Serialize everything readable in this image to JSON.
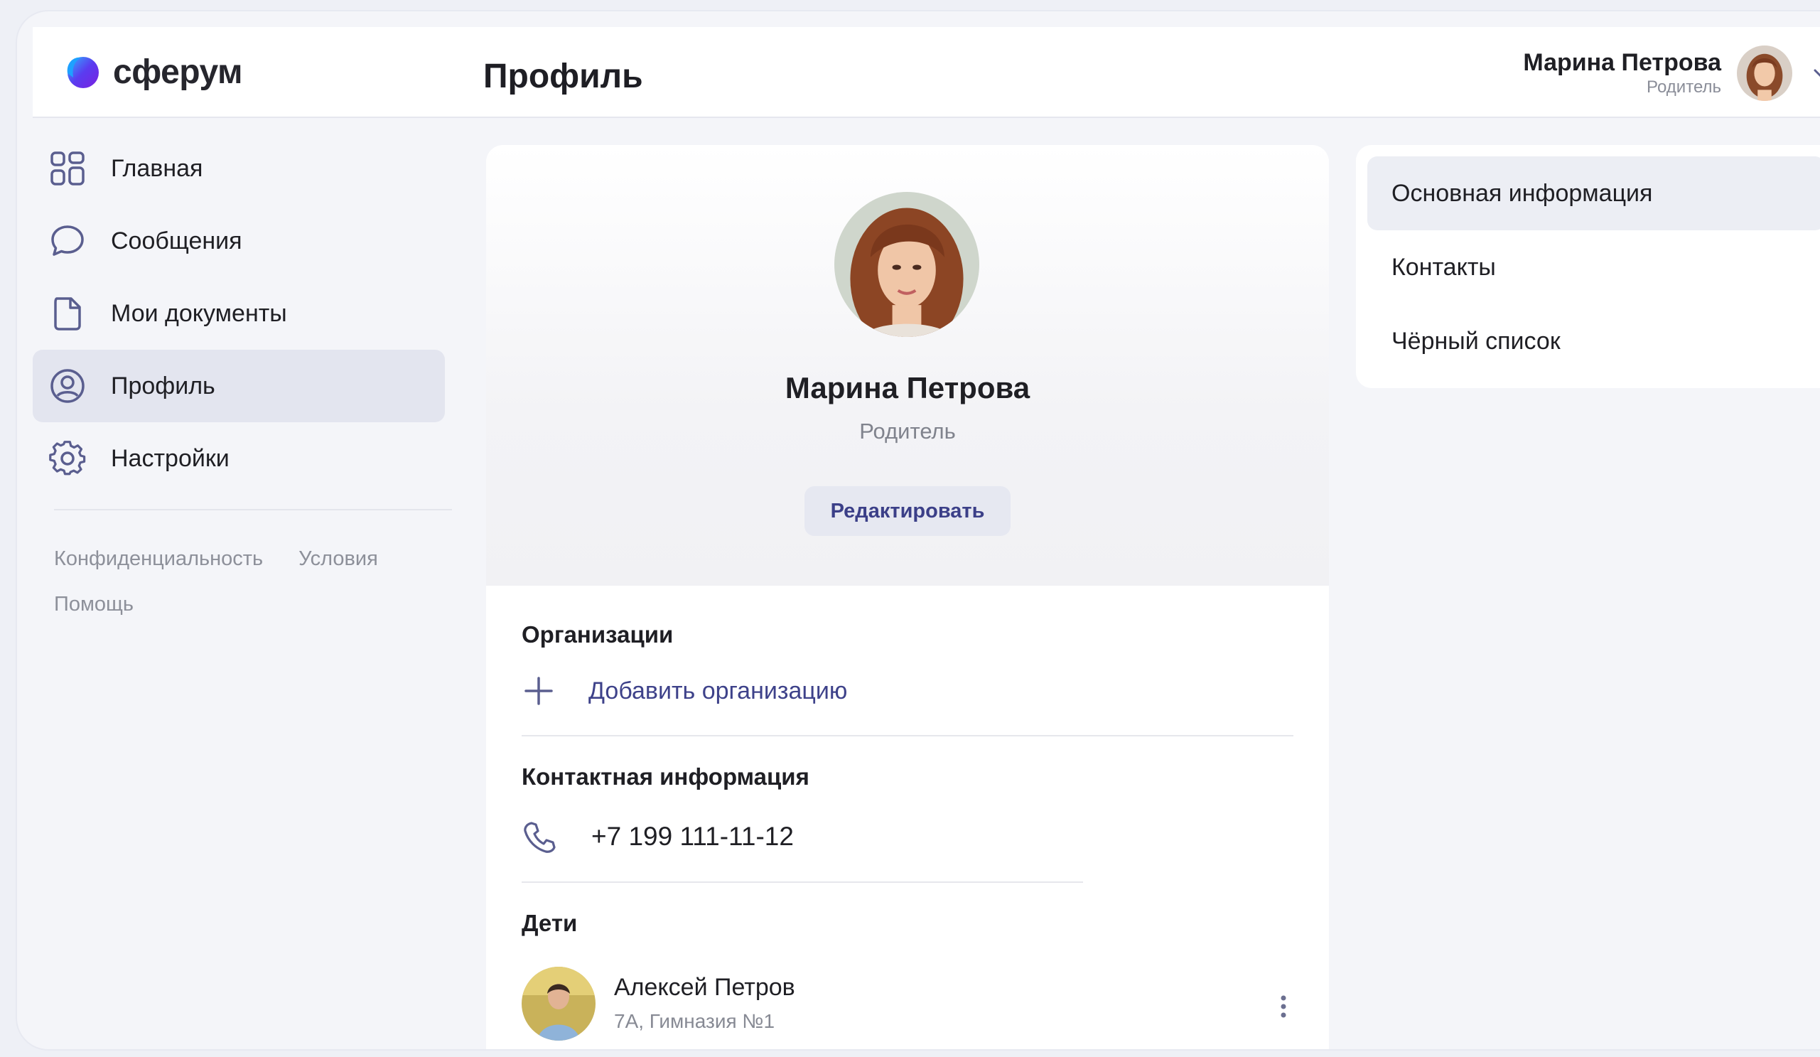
{
  "app": {
    "logo_text": "сферум",
    "page_title": "Профиль"
  },
  "user": {
    "name": "Марина Петрова",
    "role": "Родитель"
  },
  "sidebar": {
    "items": [
      {
        "label": "Главная",
        "icon": "grid-icon"
      },
      {
        "label": "Сообщения",
        "icon": "chat-bubble-icon"
      },
      {
        "label": "Мои документы",
        "icon": "document-icon"
      },
      {
        "label": "Профиль",
        "icon": "user-circle-icon",
        "active": true
      },
      {
        "label": "Настройки",
        "icon": "gear-icon"
      }
    ],
    "footer_links": [
      "Конфиденциальность",
      "Условия",
      "Помощь"
    ]
  },
  "profile": {
    "name": "Марина Петрова",
    "role": "Родитель",
    "edit_label": "Редактировать",
    "organizations_title": "Организации",
    "add_org_label": "Добавить организацию",
    "contact_title": "Контактная информация",
    "phone": "+7 199 111-11-12",
    "children_title": "Дети",
    "children": [
      {
        "name": "Алексей Петров",
        "school": "7А, Гимназия №1"
      }
    ]
  },
  "right_menu": {
    "items": [
      {
        "label": "Основная информация",
        "active": true
      },
      {
        "label": "Контакты"
      },
      {
        "label": "Чёрный список"
      }
    ]
  },
  "colors": {
    "accent": "#3e428a",
    "active_bg": "#e3e5ef",
    "page_bg": "#f4f5f9"
  }
}
